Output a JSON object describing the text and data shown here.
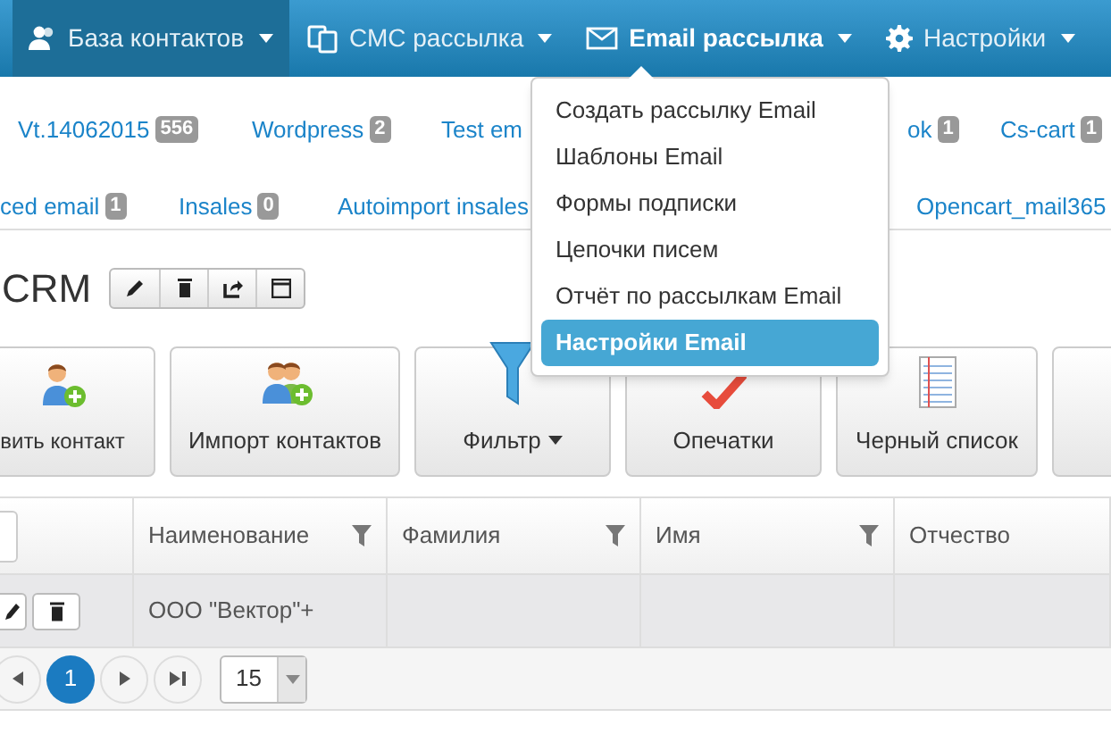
{
  "navbar": {
    "items": [
      {
        "label": "База контактов",
        "kind": "contacts",
        "selected": true,
        "expanded": false
      },
      {
        "label": "СМС рассылка",
        "kind": "sms",
        "selected": false,
        "expanded": false
      },
      {
        "label": "Email рассылка",
        "kind": "email",
        "selected": false,
        "expanded": true
      },
      {
        "label": "Настройки",
        "kind": "settings",
        "selected": false,
        "expanded": false
      }
    ]
  },
  "group_tabs": [
    [
      {
        "label": "Vt.14062015",
        "count": "556"
      },
      {
        "label": "Wordpress",
        "count": "2"
      },
      {
        "label": "Test em"
      },
      {
        "label": "ok",
        "count": "1"
      },
      {
        "label": "Cs-cart",
        "count": "1"
      }
    ],
    [
      {
        "label": "ced email",
        "count": "1"
      },
      {
        "label": "Insales",
        "count": "0"
      },
      {
        "label": "Autoimport insales"
      },
      {
        "label": "Opencart_mail365"
      }
    ]
  ],
  "dropdown": {
    "items": [
      {
        "label": "Создать рассылку Email",
        "selected": false
      },
      {
        "label": "Шаблоны Email",
        "selected": false
      },
      {
        "label": "Формы подписки",
        "selected": false
      },
      {
        "label": "Цепочки писем",
        "selected": false
      },
      {
        "label": "Отчёт по рассылкам Email",
        "selected": false
      },
      {
        "label": "Настройки Email",
        "selected": true
      }
    ]
  },
  "page_title": "CRM",
  "action_buttons": [
    {
      "label": "вить контакт",
      "kind": "add-contact",
      "dropdown": false
    },
    {
      "label": "Импорт контактов",
      "kind": "import",
      "dropdown": false
    },
    {
      "label": "Фильтр",
      "kind": "filter",
      "dropdown": true
    },
    {
      "label": "Опечатки",
      "kind": "spell",
      "dropdown": false
    },
    {
      "label": "Черный список",
      "kind": "list",
      "dropdown": false
    }
  ],
  "table": {
    "columns": [
      {
        "label": "Наименование",
        "filter": true
      },
      {
        "label": "Фамилия",
        "filter": true
      },
      {
        "label": "Имя",
        "filter": true
      },
      {
        "label": "Отчество",
        "filter": false
      }
    ],
    "rows": [
      {
        "cells": [
          "ООО \"Вектор\"+",
          "",
          "",
          ""
        ]
      }
    ]
  },
  "pager": {
    "pages": [
      {
        "label": "1",
        "selected": true
      }
    ],
    "page_size": "15"
  }
}
